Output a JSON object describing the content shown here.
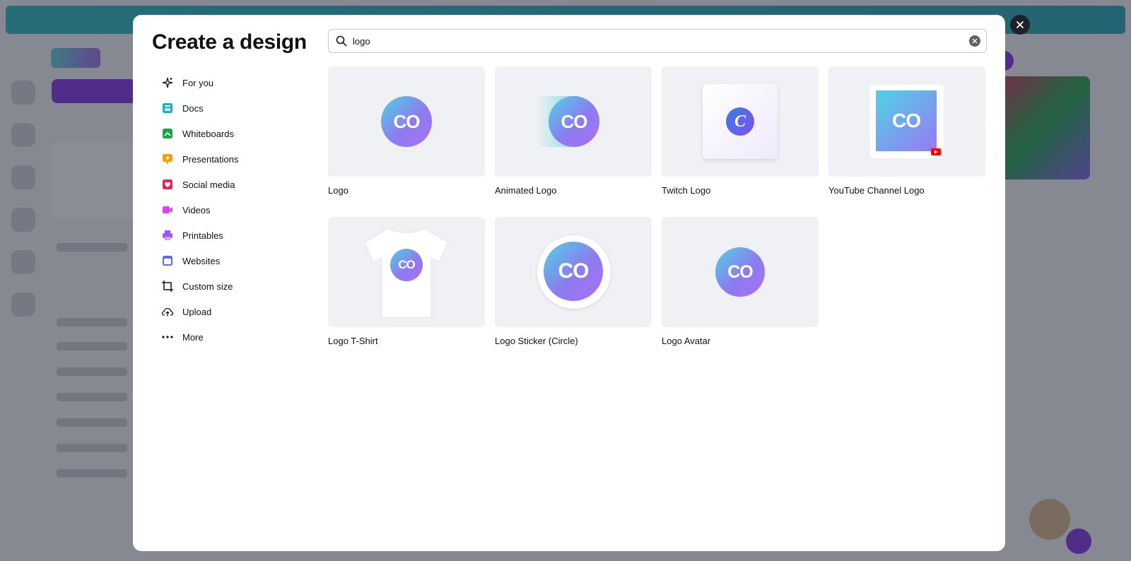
{
  "modal": {
    "title": "Create a design",
    "close_label": "Close"
  },
  "search": {
    "value": "logo",
    "placeholder": "What would you like to create?"
  },
  "categories": [
    {
      "label": "For you",
      "icon": "sparkle-icon"
    },
    {
      "label": "Docs",
      "icon": "docs-icon"
    },
    {
      "label": "Whiteboards",
      "icon": "whiteboard-icon"
    },
    {
      "label": "Presentations",
      "icon": "presentation-icon"
    },
    {
      "label": "Social media",
      "icon": "heart-icon"
    },
    {
      "label": "Videos",
      "icon": "video-icon"
    },
    {
      "label": "Printables",
      "icon": "printer-icon"
    },
    {
      "label": "Websites",
      "icon": "website-icon"
    },
    {
      "label": "Custom size",
      "icon": "crop-icon"
    },
    {
      "label": "Upload",
      "icon": "upload-cloud-icon"
    },
    {
      "label": "More",
      "icon": "more-dots-icon"
    }
  ],
  "results": [
    {
      "label": "Logo",
      "mark": "CO"
    },
    {
      "label": "Animated Logo",
      "mark": "CO"
    },
    {
      "label": "Twitch Logo",
      "mark": "C"
    },
    {
      "label": "YouTube Channel Logo",
      "mark": "CO"
    },
    {
      "label": "Logo T-Shirt",
      "mark": "CO"
    },
    {
      "label": "Logo Sticker (Circle)",
      "mark": "CO"
    },
    {
      "label": "Logo Avatar",
      "mark": "CO"
    }
  ],
  "colors": {
    "accent": "#7d2ae8",
    "text": "#0e1318",
    "thumb_bg": "#f0f1f4",
    "docs": "#13b3c6",
    "whiteboards": "#1ea446",
    "presentations": "#f59e0b",
    "social": "#e0245e",
    "videos": "#d946ef",
    "printables": "#9b59f5",
    "websites": "#5b6af0"
  }
}
